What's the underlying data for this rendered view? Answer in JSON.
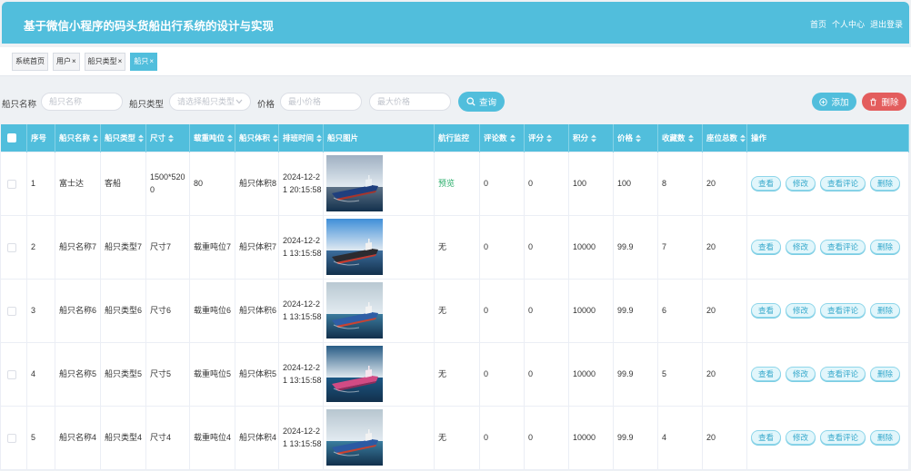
{
  "app": {
    "title": "基于微信小程序的码头货船出行系统的设计与实现"
  },
  "nav": {
    "home": "首页",
    "profile": "个人中心",
    "logout": "退出登录"
  },
  "colors": {
    "primary": "#51bedc",
    "danger": "#e35d5d",
    "link": "#2aae6b"
  },
  "tabs": [
    {
      "label": "系统首页"
    },
    {
      "label": "用户",
      "close": "×"
    },
    {
      "label": "船只类型",
      "close": "×"
    },
    {
      "label": "船只",
      "close": "×",
      "active": true
    }
  ],
  "search": {
    "name_label": "船只名称",
    "name_placeholder": "船只名称",
    "type_label": "船只类型",
    "type_placeholder": "请选择船只类型",
    "type_select_icon": "chevron-down-icon",
    "price_label": "价格",
    "min_price_placeholder": "最小价格",
    "max_price_placeholder": "最大价格",
    "query_label": "查询",
    "query_icon": "search-icon"
  },
  "toolbar": {
    "add_label": "添加",
    "add_icon": "plus-circle-icon",
    "delete_label": "删除",
    "delete_icon": "trash-icon"
  },
  "table": {
    "select_all_checked": false,
    "columns": [
      {
        "label": "序号",
        "sortable": false
      },
      {
        "label": "船只名称",
        "sortable": true
      },
      {
        "label": "船只类型",
        "sortable": true
      },
      {
        "label": "尺寸",
        "sortable": true
      },
      {
        "label": "载重吨位",
        "sortable": true
      },
      {
        "label": "船只体积",
        "sortable": true
      },
      {
        "label": "排班时间",
        "sortable": true
      },
      {
        "label": "船只图片",
        "sortable": false
      },
      {
        "label": "航行监控",
        "sortable": false
      },
      {
        "label": "评论数",
        "sortable": true
      },
      {
        "label": "评分",
        "sortable": true
      },
      {
        "label": "积分",
        "sortable": true
      },
      {
        "label": "价格",
        "sortable": true
      },
      {
        "label": "收藏数",
        "sortable": true
      },
      {
        "label": "座位总数",
        "sortable": true
      },
      {
        "label": "操作",
        "sortable": false
      }
    ],
    "rows": [
      {
        "index": 1,
        "name": "富士达",
        "type": "客船",
        "size": "1500*5200",
        "tonnage": "80",
        "volume": "船只体积8",
        "schedule": "2024-12-21 20:15:58",
        "monitor": "预览",
        "monitor_is_link": true,
        "comments": 0,
        "rating": 0,
        "points": 100,
        "price": 100,
        "favorites": 8,
        "seats": 20,
        "photo": {
          "sky": "#9fb0c2",
          "sea": "#5e7287",
          "hull": "#1f3f7e",
          "stripe": "#a8342a",
          "deck": "#e9eef2"
        }
      },
      {
        "index": 2,
        "name": "船只名称7",
        "type": "船只类型7",
        "size": "尺寸7",
        "tonnage": "载重吨位7",
        "volume": "船只体积7",
        "schedule": "2024-12-21 13:15:58",
        "monitor": "无",
        "monitor_is_link": false,
        "comments": 0,
        "rating": 0,
        "points": 10000,
        "price": 99.9,
        "favorites": 7,
        "seats": 20,
        "photo": {
          "sky": "#3f8fd8",
          "sea": "#3d6d9c",
          "hull": "#2b2b30",
          "stripe": "#c43a2e",
          "deck": "#f1f1f1"
        }
      },
      {
        "index": 3,
        "name": "船只名称6",
        "type": "船只类型6",
        "size": "尺寸6",
        "tonnage": "载重吨位6",
        "volume": "船只体积6",
        "schedule": "2024-12-21 13:15:58",
        "monitor": "无",
        "monitor_is_link": false,
        "comments": 0,
        "rating": 0,
        "points": 10000,
        "price": 99.9,
        "favorites": 6,
        "seats": 20,
        "photo": {
          "sky": "#b9c8d2",
          "sea": "#3b7b9d",
          "hull": "#2f5ea6",
          "stripe": "#c94332",
          "deck": "#f3f3f3"
        }
      },
      {
        "index": 4,
        "name": "船只名称5",
        "type": "船只类型5",
        "size": "尺寸5",
        "tonnage": "载重吨位5",
        "volume": "船只体积5",
        "schedule": "2024-12-21 13:15:58",
        "monitor": "无",
        "monitor_is_link": false,
        "comments": 0,
        "rating": 0,
        "points": 10000,
        "price": 99.9,
        "favorites": 5,
        "seats": 20,
        "photo": {
          "sky": "#285c86",
          "sea": "#1d5884",
          "hull": "#d14b84",
          "stripe": "#8e2c5a",
          "deck": "#f6e6ee"
        }
      },
      {
        "index": 5,
        "name": "船只名称4",
        "type": "船只类型4",
        "size": "尺寸4",
        "tonnage": "载重吨位4",
        "volume": "船只体积4",
        "schedule": "2024-12-21 13:15:58",
        "monitor": "无",
        "monitor_is_link": false,
        "comments": 0,
        "rating": 0,
        "points": 10000,
        "price": 99.9,
        "favorites": 4,
        "seats": 20,
        "photo": {
          "sky": "#b7c6d0",
          "sea": "#3a7d9f",
          "hull": "#2c5aa3",
          "stripe": "#c64231",
          "deck": "#f2f2f2"
        }
      }
    ],
    "row_actions": {
      "view": "查看",
      "edit": "修改",
      "comments": "查看评论",
      "delete": "删除"
    }
  }
}
